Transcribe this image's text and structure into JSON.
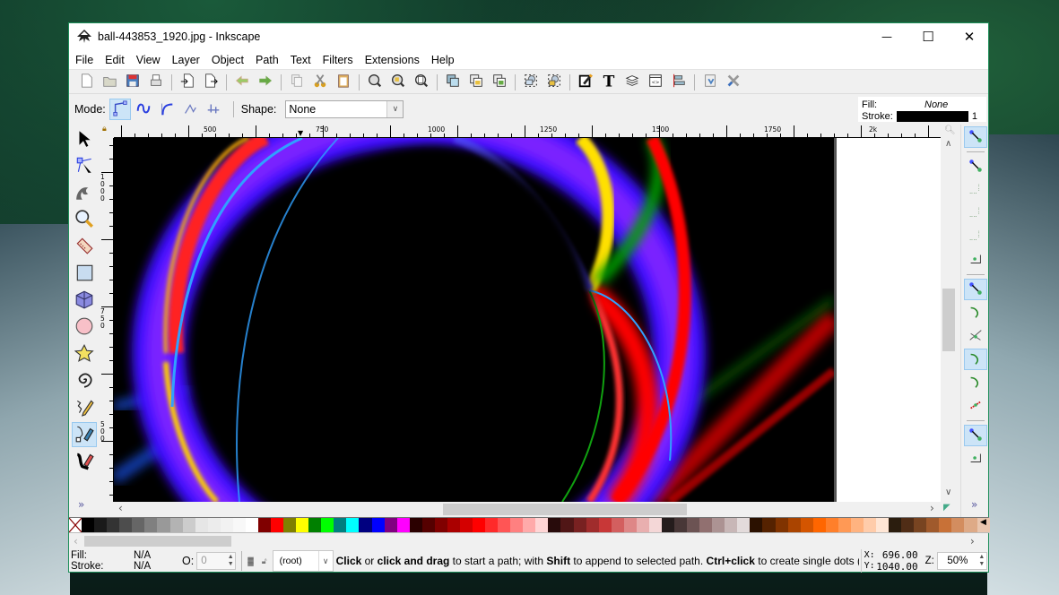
{
  "window": {
    "title": "ball-443853_1920.jpg - Inkscape",
    "controls": {
      "minimize": "—",
      "maximize": "☐",
      "close": "✕"
    }
  },
  "menu": [
    "File",
    "Edit",
    "View",
    "Layer",
    "Object",
    "Path",
    "Text",
    "Filters",
    "Extensions",
    "Help"
  ],
  "commands_toolbar": [
    {
      "name": "new-document",
      "icon": "new-icon"
    },
    {
      "name": "open",
      "icon": "folder-icon"
    },
    {
      "name": "save",
      "icon": "save-icon"
    },
    {
      "name": "print",
      "icon": "print-icon"
    },
    {
      "sep": true
    },
    {
      "name": "import",
      "icon": "import-icon"
    },
    {
      "name": "export",
      "icon": "export-icon"
    },
    {
      "sep": true
    },
    {
      "name": "undo",
      "icon": "undo-icon"
    },
    {
      "name": "redo",
      "icon": "redo-icon"
    },
    {
      "sep": true
    },
    {
      "name": "copy",
      "icon": "copy-icon"
    },
    {
      "name": "cut",
      "icon": "cut-icon"
    },
    {
      "name": "paste",
      "icon": "paste-icon"
    },
    {
      "sep": true
    },
    {
      "name": "zoom-selection",
      "icon": "zoom-selection-icon"
    },
    {
      "name": "zoom-drawing",
      "icon": "zoom-drawing-icon"
    },
    {
      "name": "zoom-page",
      "icon": "zoom-page-icon"
    },
    {
      "sep": true
    },
    {
      "name": "duplicate",
      "icon": "duplicate-icon"
    },
    {
      "name": "clone",
      "icon": "clone-icon"
    },
    {
      "name": "unlink-clone",
      "icon": "unlink-clone-icon"
    },
    {
      "sep": true
    },
    {
      "name": "group",
      "icon": "group-icon"
    },
    {
      "name": "ungroup",
      "icon": "ungroup-icon"
    },
    {
      "sep": true
    },
    {
      "name": "fill-stroke",
      "icon": "fill-stroke-icon"
    },
    {
      "name": "text-font",
      "icon": "text-icon"
    },
    {
      "name": "layers",
      "icon": "layers-icon"
    },
    {
      "name": "xml-editor",
      "icon": "xml-editor-icon"
    },
    {
      "name": "align-distribute",
      "icon": "align-icon"
    },
    {
      "sep": true
    },
    {
      "name": "document-properties",
      "icon": "document-properties-icon"
    },
    {
      "name": "preferences",
      "icon": "preferences-icon"
    }
  ],
  "controls_bar": {
    "mode_label": "Mode:",
    "modes": [
      {
        "name": "regular-bezier",
        "active": true
      },
      {
        "name": "spiro",
        "active": false
      },
      {
        "name": "bspline",
        "active": false
      },
      {
        "name": "zigzag",
        "active": false
      },
      {
        "name": "paraxial",
        "active": false
      }
    ],
    "shape_label": "Shape:",
    "shape_value": "None"
  },
  "fill_stroke_indicator": {
    "fill_label": "Fill:",
    "fill_value": "None",
    "stroke_label": "Stroke:",
    "stroke_color": "#000000",
    "stroke_width": "1"
  },
  "tools": [
    {
      "name": "selector",
      "active": false
    },
    {
      "name": "node",
      "active": false
    },
    {
      "name": "tweak",
      "active": false
    },
    {
      "name": "zoom",
      "active": false
    },
    {
      "name": "measure",
      "active": false
    },
    {
      "name": "rectangle",
      "active": false
    },
    {
      "name": "3d-box",
      "active": false
    },
    {
      "name": "ellipse",
      "active": false
    },
    {
      "name": "star",
      "active": false
    },
    {
      "name": "spiral",
      "active": false
    },
    {
      "name": "pencil",
      "active": false
    },
    {
      "name": "pen",
      "active": true
    },
    {
      "name": "calligraphy",
      "active": false
    }
  ],
  "tools_more": "»",
  "ruler": {
    "h_labels": [
      "500",
      "750",
      "1000",
      "1250",
      "1500",
      "1750",
      "2k"
    ],
    "v_labels": [
      "1000",
      "750",
      "500"
    ]
  },
  "snap_controls": [
    {
      "name": "snap-enable",
      "active": true
    },
    {
      "sep": true
    },
    {
      "name": "snap-bbox",
      "active": false
    },
    {
      "name": "snap-bbox-edge",
      "active": false
    },
    {
      "name": "snap-bbox-corner",
      "active": false
    },
    {
      "name": "snap-bbox-edge-midpoint",
      "active": false
    },
    {
      "name": "snap-bbox-center",
      "active": false
    },
    {
      "sep": true
    },
    {
      "name": "snap-nodes",
      "active": true
    },
    {
      "name": "snap-path",
      "active": false
    },
    {
      "name": "snap-path-intersection",
      "active": false
    },
    {
      "name": "snap-cusp-nodes",
      "active": true
    },
    {
      "name": "snap-smooth-nodes",
      "active": false
    },
    {
      "name": "snap-line-midpoints",
      "active": false
    },
    {
      "sep": true
    },
    {
      "name": "snap-others",
      "active": true
    },
    {
      "name": "snap-object-center",
      "active": false
    }
  ],
  "snap_more": "»",
  "palette": [
    "none",
    "#000000",
    "#1a1a1a",
    "#333333",
    "#4d4d4d",
    "#666666",
    "#808080",
    "#999999",
    "#b3b3b3",
    "#cccccc",
    "#e6e6e6",
    "#ececec",
    "#f2f2f2",
    "#f8f8f8",
    "#ffffff",
    "#800000",
    "#ff0000",
    "#808000",
    "#ffff00",
    "#008000",
    "#00ff00",
    "#008080",
    "#00ffff",
    "#000080",
    "#0000ff",
    "#800080",
    "#ff00ff",
    "#2b0000",
    "#550000",
    "#800000",
    "#aa0000",
    "#d40000",
    "#ff0000",
    "#ff2a2a",
    "#ff5555",
    "#ff8080",
    "#ffaaaa",
    "#ffd5d5",
    "#280b0b",
    "#501616",
    "#782121",
    "#a02c2c",
    "#c83737",
    "#d35f5f",
    "#de8787",
    "#e9afaf",
    "#f4d7d7",
    "#241c1c",
    "#483737",
    "#6c5353",
    "#917070",
    "#ac9393",
    "#c8b7b7",
    "#e3dbdb",
    "#2b1100",
    "#552200",
    "#803300",
    "#aa4400",
    "#d45500",
    "#ff6600",
    "#ff7f2a",
    "#ff9955",
    "#ffb380",
    "#ffccaa",
    "#ffe6d5",
    "#2b1d0e",
    "#502d16",
    "#784421",
    "#a05a2c",
    "#c87137",
    "#d38d5f",
    "#deaa87",
    "#e9c6af"
  ],
  "statusbar": {
    "fill_label": "Fill:",
    "fill_value": "N/A",
    "stroke_label": "Stroke:",
    "stroke_value": "N/A",
    "opacity_label": "O:",
    "opacity_value": "0",
    "layer_value": "(root)",
    "message": [
      {
        "text": "Click",
        "bold": true
      },
      {
        "text": " or ",
        "bold": false
      },
      {
        "text": "click and drag",
        "bold": true
      },
      {
        "text": " to start a path; with ",
        "bold": false
      },
      {
        "text": "Shift",
        "bold": true
      },
      {
        "text": " to append to selected path. ",
        "bold": false
      },
      {
        "text": "Ctrl+click",
        "bold": true
      },
      {
        "text": " to create single dots (...",
        "bold": false
      }
    ],
    "x_label": "X:",
    "x_value": "696.00",
    "y_label": "Y:",
    "y_value": "1040.00",
    "zoom_label": "Z:",
    "zoom_value": "50%"
  }
}
